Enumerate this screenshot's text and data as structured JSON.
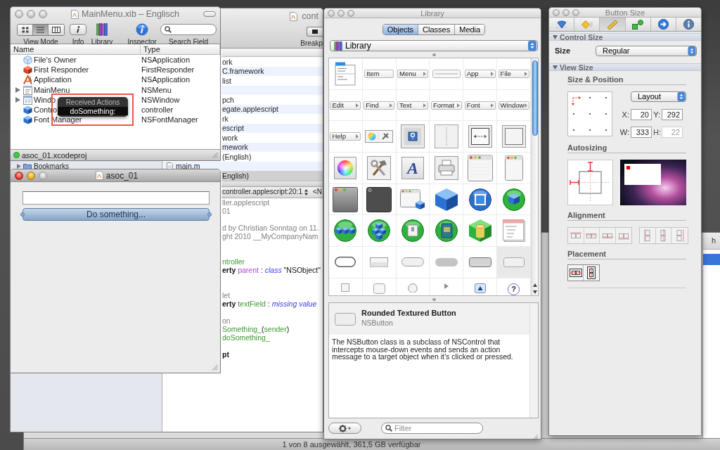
{
  "main_menu_window": {
    "title": "MainMenu.xib – Englisch",
    "active": false,
    "toolbar": [
      {
        "kind": "view-mode",
        "label": "View Mode"
      },
      {
        "kind": "info",
        "label": "Info"
      },
      {
        "kind": "library",
        "label": "Library"
      },
      {
        "kind": "inspector",
        "label": "Inspector"
      },
      {
        "kind": "search",
        "label": "Search Field"
      }
    ],
    "view_modes": [
      {
        "kind": "icons",
        "selected": false
      },
      {
        "kind": "list",
        "selected": true
      },
      {
        "kind": "columns",
        "selected": false
      }
    ],
    "columns": [
      "Name",
      "Type"
    ],
    "rows": [
      {
        "kind": "placeholder",
        "name": "File's Owner",
        "type": "NSApplication"
      },
      {
        "kind": "responder",
        "name": "First Responder",
        "type": "FirstResponder"
      },
      {
        "kind": "application",
        "name": "Application",
        "type": "NSApplication"
      },
      {
        "kind": "menu",
        "name": "MainMenu",
        "type": "NSMenu",
        "expanded": false
      },
      {
        "kind": "window",
        "name": "Windo",
        "type": "NSWindow",
        "expanded": false
      },
      {
        "kind": "object",
        "name": "Contro",
        "type": "controller"
      },
      {
        "kind": "object",
        "name": "Font Manager",
        "type": "NSFontManager"
      }
    ],
    "status": "asoc_01.xcodeproj"
  },
  "actions_popup": {
    "title": "Received Actions",
    "actions": [
      "doSomething:"
    ]
  },
  "project_window": {
    "title": "cont",
    "toolbar_label": "Breakp",
    "sidebar_item": "Bookmarks",
    "files": [
      {
        "name": "ork",
        "clipped": true,
        "selected": false
      },
      {
        "name": "C.framework",
        "clipped": true,
        "selected": false
      },
      {
        "name": "list",
        "clipped": true,
        "selected": false
      },
      {
        "selected": false
      },
      {
        "name": "pch",
        "clipped": true,
        "selected": false
      },
      {
        "name": "egate.applescript",
        "clipped": true,
        "selected": false
      },
      {
        "name": "rk",
        "clipped": true,
        "selected": false
      },
      {
        "name": "escript",
        "clipped": true,
        "selected": false
      },
      {
        "name": "work",
        "clipped": true,
        "selected": false
      },
      {
        "name": "mework",
        "clipped": true,
        "selected": false
      },
      {
        "name": "(English)",
        "clipped": true,
        "selected": false
      },
      {
        "name": "main.m",
        "clipped": false,
        "selected": false
      },
      {
        "name": "English)",
        "clipped": true,
        "selected": true
      }
    ],
    "navigator": {
      "location": "controller.applescript:20:1",
      "symbol": "<N"
    },
    "code": [
      {
        "kind": "code",
        "tokens": [
          {
            "kind": "comment",
            "text": "ller.applescript"
          }
        ]
      },
      {
        "kind": "code",
        "tokens": [
          {
            "kind": "comment",
            "text": "01"
          }
        ]
      },
      {
        "kind": "blank"
      },
      {
        "kind": "code",
        "tokens": [
          {
            "kind": "comment",
            "text": "d by Christian Sonntag on 11."
          }
        ]
      },
      {
        "kind": "code",
        "tokens": [
          {
            "kind": "comment",
            "text": "ght 2010 __MyCompanyNam"
          }
        ]
      },
      {
        "kind": "blank"
      },
      {
        "kind": "blank"
      },
      {
        "kind": "code",
        "tokens": [
          {
            "kind": "identifier",
            "text": "ntroller"
          }
        ]
      },
      {
        "kind": "code",
        "tokens": [
          {
            "kind": "keyword",
            "text": "erty "
          },
          {
            "kind": "property",
            "text": "parent"
          },
          {
            "kind": "plain",
            "text": " : "
          },
          {
            "kind": "class",
            "text": "class"
          },
          {
            "kind": "plain",
            "text": " \"NSObject\""
          }
        ]
      },
      {
        "kind": "blank"
      },
      {
        "kind": "blank"
      },
      {
        "kind": "code",
        "tokens": [
          {
            "kind": "comment",
            "text": "let"
          }
        ]
      },
      {
        "kind": "code",
        "tokens": [
          {
            "kind": "keyword",
            "text": "erty "
          },
          {
            "kind": "identifier",
            "text": "textField"
          },
          {
            "kind": "plain",
            "text": " : "
          },
          {
            "kind": "class",
            "text": "missing value"
          }
        ]
      },
      {
        "kind": "blank"
      },
      {
        "kind": "code",
        "tokens": [
          {
            "kind": "comment",
            "text": "on"
          }
        ]
      },
      {
        "kind": "code",
        "tokens": [
          {
            "kind": "identifier",
            "text": "Something_"
          },
          {
            "kind": "plain",
            "text": "("
          },
          {
            "kind": "identifier",
            "text": "sender"
          },
          {
            "kind": "plain",
            "text": ")"
          }
        ]
      },
      {
        "kind": "code",
        "tokens": [
          {
            "kind": "identifier",
            "text": "doSomething_"
          }
        ]
      },
      {
        "kind": "blank"
      },
      {
        "kind": "code",
        "tokens": [
          {
            "kind": "keyword",
            "text": "pt"
          }
        ]
      }
    ]
  },
  "app_window": {
    "title": "asoc_01",
    "active": true,
    "button": {
      "label": "Do something...",
      "selected": true
    }
  },
  "library_window": {
    "title": "Library",
    "active": false,
    "tabs": [
      {
        "label": "Objects",
        "selected": true
      },
      {
        "label": "Classes",
        "selected": false
      },
      {
        "label": "Media",
        "selected": false
      }
    ],
    "collection": "Library",
    "items": [
      {
        "kind": "menu",
        "selected": false
      },
      {
        "kind": "menu-item",
        "label": "Item",
        "selected": false
      },
      {
        "kind": "submenu",
        "label": "Menu",
        "selected": false
      },
      {
        "kind": "separator",
        "selected": false
      },
      {
        "kind": "submenu",
        "label": "App",
        "selected": false
      },
      {
        "kind": "submenu",
        "label": "File",
        "selected": false
      },
      {
        "kind": "submenu",
        "label": "Edit",
        "selected": false
      },
      {
        "kind": "submenu",
        "label": "Find",
        "selected": false
      },
      {
        "kind": "submenu",
        "label": "Text",
        "selected": false
      },
      {
        "kind": "submenu",
        "label": "Format",
        "selected": false
      },
      {
        "kind": "submenu",
        "label": "Font",
        "selected": false
      },
      {
        "kind": "submenu",
        "label": "Window",
        "selected": false
      },
      {
        "kind": "submenu",
        "label": "Help",
        "selected": false
      },
      {
        "kind": "palettes",
        "selected": false
      },
      {
        "kind": "help-tile",
        "selected": false
      },
      {
        "kind": "vertical-line",
        "selected": false
      },
      {
        "kind": "split-view",
        "selected": false
      },
      {
        "kind": "box",
        "selected": false
      },
      {
        "kind": "color-wheel",
        "selected": false
      },
      {
        "kind": "tools",
        "selected": false
      },
      {
        "kind": "font-panel",
        "label": "A",
        "selected": false
      },
      {
        "kind": "printer",
        "selected": false
      },
      {
        "kind": "window",
        "selected": false
      },
      {
        "kind": "panel",
        "selected": false
      },
      {
        "kind": "textured-window",
        "selected": false
      },
      {
        "kind": "hud-window",
        "selected": false
      },
      {
        "kind": "window-cube",
        "selected": false
      },
      {
        "kind": "cube",
        "selected": false
      },
      {
        "kind": "view-sphere",
        "selected": false
      },
      {
        "kind": "cube-sphere",
        "selected": false
      },
      {
        "kind": "blocks-sphere",
        "selected": false
      },
      {
        "kind": "pyramid-sphere",
        "selected": false
      },
      {
        "kind": "switch-sphere",
        "selected": false
      },
      {
        "kind": "book-sphere",
        "selected": false
      },
      {
        "kind": "cylinder-cube",
        "selected": false
      },
      {
        "kind": "table",
        "selected": false
      },
      {
        "kind": "pill-button",
        "selected": false
      },
      {
        "kind": "gradient-button",
        "selected": false
      },
      {
        "kind": "round-rect-button",
        "selected": false
      },
      {
        "kind": "recessed-button",
        "selected": false
      },
      {
        "kind": "textured-button",
        "selected": false
      },
      {
        "kind": "rounded-textured-button",
        "selected": true
      },
      {
        "kind": "square-button",
        "selected": false
      },
      {
        "kind": "bevel-button",
        "selected": false
      },
      {
        "kind": "round-button",
        "selected": false
      },
      {
        "kind": "disclosure",
        "selected": false
      },
      {
        "kind": "arrow-tile",
        "selected": false
      },
      {
        "kind": "help-button",
        "label": "?",
        "selected": false
      }
    ],
    "detail": {
      "name": "Rounded Textured Button",
      "class": "NSButton",
      "description": "The NSButton class is a subclass of NSControl that intercepts mouse-down events and sends an action message to a target object when it’s clicked or pressed."
    },
    "filter": {
      "placeholder": "Filter"
    }
  },
  "inspector_window": {
    "title": "Button Size",
    "active": false,
    "tabs": [
      {
        "kind": "attributes",
        "selected": false
      },
      {
        "kind": "effects",
        "selected": false
      },
      {
        "kind": "size",
        "selected": true
      },
      {
        "kind": "connections",
        "selected": false
      },
      {
        "kind": "bindings",
        "selected": false
      },
      {
        "kind": "identity",
        "selected": false
      }
    ],
    "control_size": {
      "header": "Control Size",
      "expanded": true,
      "label": "Size",
      "value": "Regular"
    },
    "view_size": {
      "header": "View Size",
      "expanded": true,
      "position_title": "Size & Position",
      "layout": "Layout",
      "fields": [
        {
          "label": "X:",
          "value": "20",
          "disabled": false
        },
        {
          "label": "Y:",
          "value": "292",
          "disabled": false
        },
        {
          "label": "W:",
          "value": "333",
          "disabled": false
        },
        {
          "label": "H:",
          "value": "22",
          "disabled": true
        }
      ],
      "autosizing_title": "Autosizing",
      "alignment_title": "Alignment",
      "placement_title": "Placement"
    }
  },
  "finder_window": {
    "partial_label": "h",
    "status": "1 von 8 ausgewählt, 361,5 GB verfügbar"
  }
}
